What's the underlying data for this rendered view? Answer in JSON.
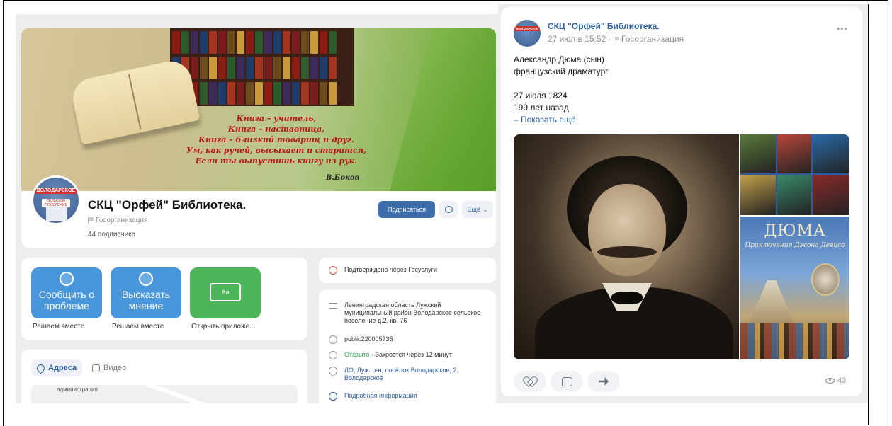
{
  "left_panel": {
    "cover": {
      "poem_lines": [
        "Книга – учитель,",
        "Книга – наставница,",
        "Книга – близкий товарищ и друг.",
        "Ум, как ручей, высыхает и старится,",
        "Если ты выпустишь книгу из рук."
      ],
      "poem_author": "В.Боков"
    },
    "avatar_text": "ВОЛОДАРСКОЕ",
    "avatar_subtext": "СЕЛЬСКОЕ ПОСЕЛЕНИЕ",
    "group_title": "СКЦ \"Орфей\" Библиотека.",
    "group_type": "Госорганизация",
    "subscribers": "44 подписчика",
    "buttons": {
      "subscribe": "Подписаться",
      "more": "Ещё"
    },
    "apps": [
      {
        "title": "Сообщить о проблеме",
        "caption": "Решаем вместе",
        "color": "#4a96db"
      },
      {
        "title": "Высказать мнение",
        "caption": "Решаем вместе",
        "color": "#4a96db"
      },
      {
        "title": "",
        "caption": "Открыть приложе...",
        "color": "#4cb55a",
        "icon_text": "Aa"
      }
    ],
    "tabs": {
      "addresses": "Адреса",
      "video": "Видео"
    },
    "map_label": "администрация",
    "gosuslugi": "Подтверждено через Госуслуги",
    "info": {
      "address": "Ленинградская область Лужский муниципальный район Володарское сельское поселение д.2, кв. 76",
      "public_id": "public220005735",
      "status_open": "Открыто",
      "status_rest": " · Закроется через 12 минут",
      "location": "ЛО, Луж. р-н, посёлок Володарское, 2, Володарское",
      "details": "Подробная информация"
    }
  },
  "right_panel": {
    "author": "СКЦ \"Орфей\" Библиотека.",
    "avatar_text": "ВОЛОДАРСКОЕ",
    "meta_date": "27 июл в 15:52",
    "meta_type": "Госорганизация",
    "text_lines": [
      "Александр Дюма (сын)",
      "французский драматург",
      "",
      "27 июля 1824",
      "199 лет назад"
    ],
    "show_more": "– Показать ещё",
    "book_cover": {
      "title": "ДЮМА",
      "subtitle": "Приключения Джона Девиса"
    },
    "views": "43"
  }
}
